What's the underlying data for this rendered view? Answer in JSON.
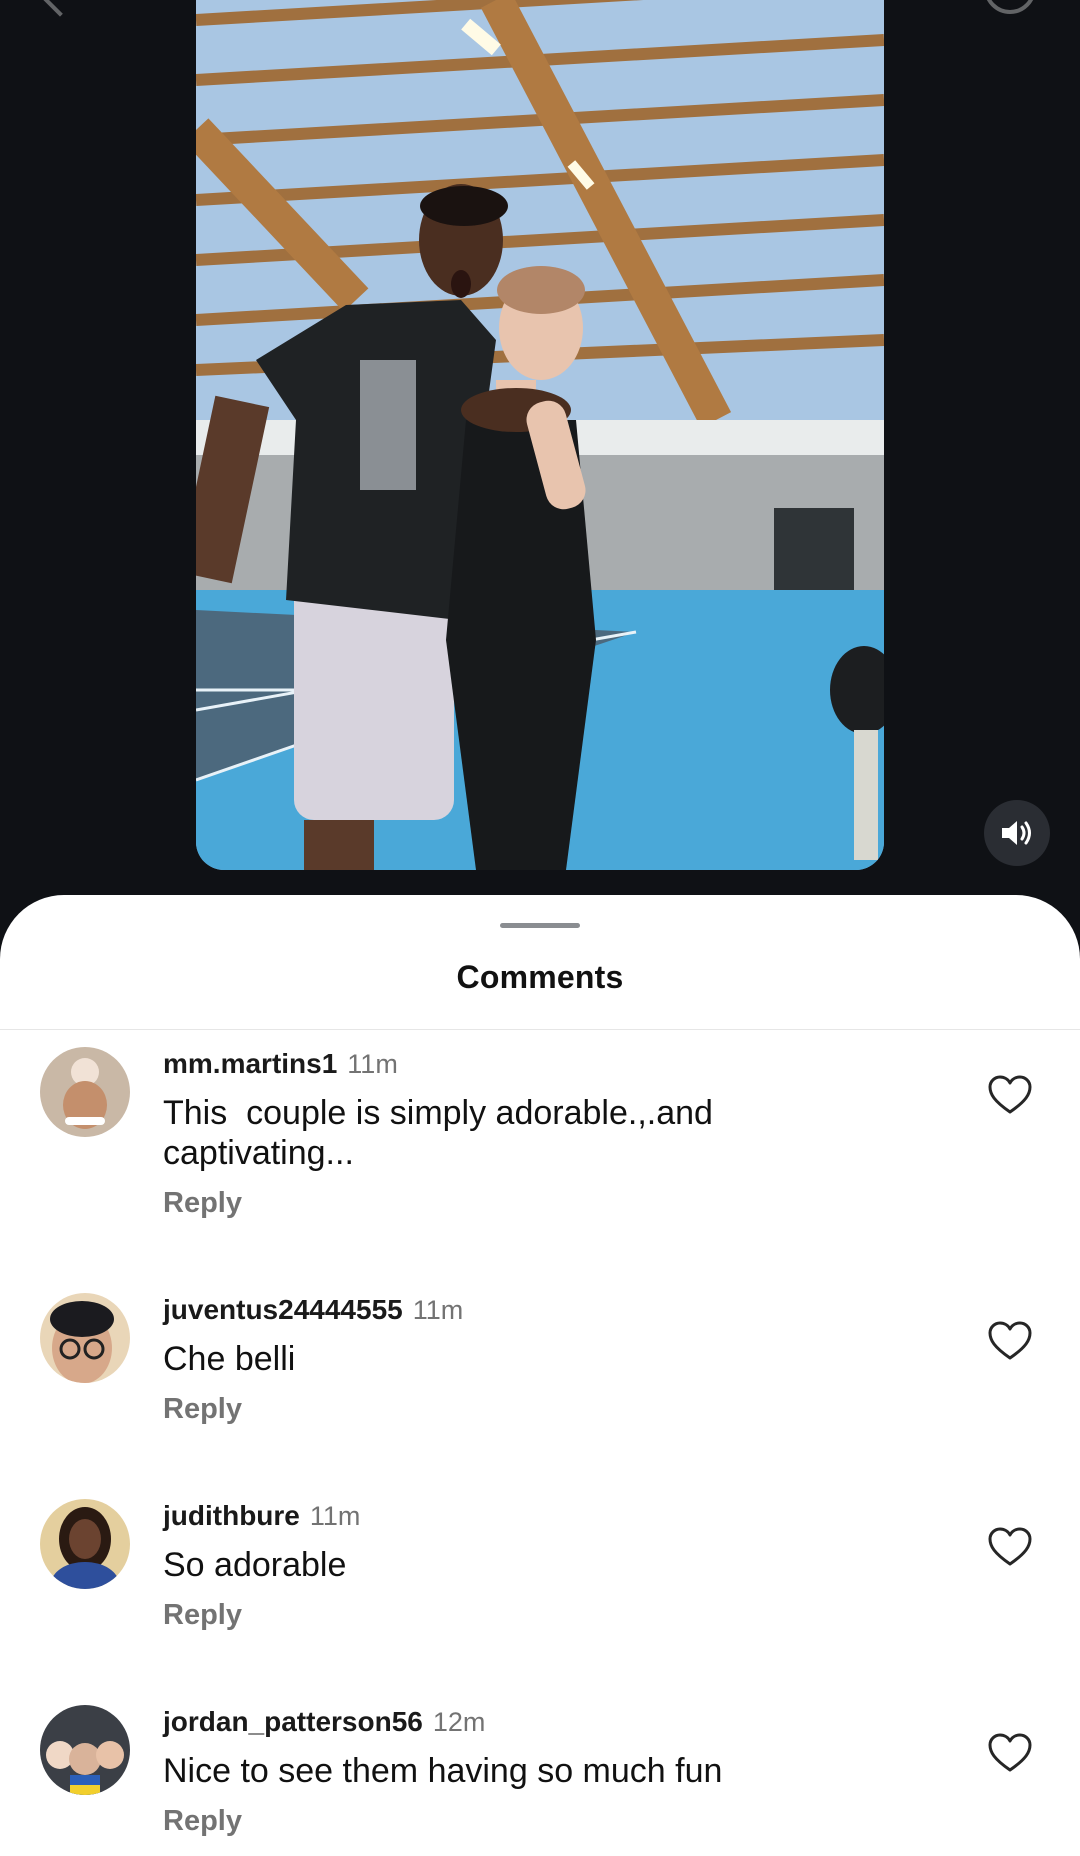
{
  "video": {
    "volume_icon": "volume-icon"
  },
  "comments_sheet": {
    "title": "Comments",
    "comments": [
      {
        "username": "mm.martins1",
        "time": "11m",
        "text": "This  couple is simply adorable.,.and\ncaptivating...",
        "reply_label": "Reply",
        "like_icon": "heart-outline-icon"
      },
      {
        "username": "juventus24444555",
        "time": "11m",
        "text": "Che belli",
        "reply_label": "Reply",
        "like_icon": "heart-outline-icon"
      },
      {
        "username": "judithbure",
        "time": "11m",
        "text": "So adorable",
        "reply_label": "Reply",
        "like_icon": "heart-outline-icon"
      },
      {
        "username": "jordan_patterson56",
        "time": "12m",
        "text": "Nice to see them having so much fun",
        "reply_label": "Reply",
        "like_icon": "heart-outline-icon"
      }
    ]
  },
  "colors": {
    "background": "#0f1115",
    "sheet": "#ffffff",
    "secondary_text": "#737373",
    "court_blue": "#4aa8d8"
  }
}
